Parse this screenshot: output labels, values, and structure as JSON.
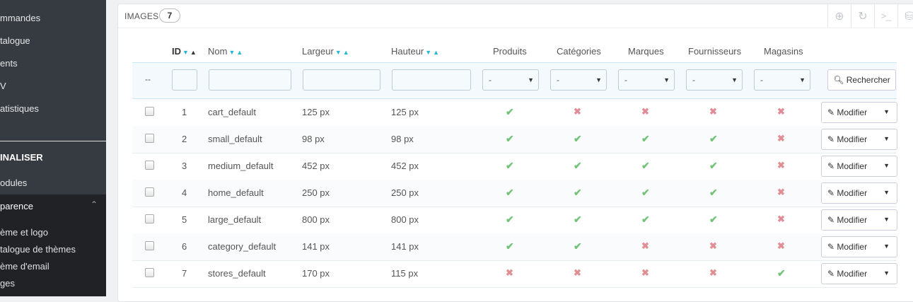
{
  "sidebar": {
    "items": [
      "mmandes",
      "talogue",
      "ents",
      "V",
      "atistiques"
    ],
    "section": "INALISER",
    "modules": "odules",
    "active": "parence",
    "sub": [
      "ème et logo",
      "talogue de thèmes",
      "ème d'email",
      "ges"
    ]
  },
  "panel": {
    "title": "IMAGES",
    "count": "7",
    "tools": [
      "plus-circle-icon",
      "refresh-icon",
      "terminal-icon",
      "database-icon"
    ]
  },
  "table": {
    "headers": {
      "id": "ID",
      "name": "Nom",
      "width": "Largeur",
      "height": "Hauteur",
      "products": "Produits",
      "categories": "Catégories",
      "brands": "Marques",
      "suppliers": "Fournisseurs",
      "stores": "Magasins"
    },
    "filter": {
      "dash": "--",
      "select_value": "-",
      "search_label": "Rechercher"
    },
    "rows": [
      {
        "id": "1",
        "name": "cart_default",
        "width": "125 px",
        "height": "125 px",
        "flags": [
          true,
          false,
          false,
          false,
          false
        ]
      },
      {
        "id": "2",
        "name": "small_default",
        "width": "98 px",
        "height": "98 px",
        "flags": [
          true,
          true,
          true,
          true,
          false
        ]
      },
      {
        "id": "3",
        "name": "medium_default",
        "width": "452 px",
        "height": "452 px",
        "flags": [
          true,
          true,
          true,
          true,
          false
        ]
      },
      {
        "id": "4",
        "name": "home_default",
        "width": "250 px",
        "height": "250 px",
        "flags": [
          true,
          true,
          true,
          true,
          false
        ]
      },
      {
        "id": "5",
        "name": "large_default",
        "width": "800 px",
        "height": "800 px",
        "flags": [
          true,
          true,
          true,
          true,
          false
        ]
      },
      {
        "id": "6",
        "name": "category_default",
        "width": "141 px",
        "height": "141 px",
        "flags": [
          true,
          true,
          false,
          false,
          false
        ]
      },
      {
        "id": "7",
        "name": "stores_default",
        "width": "170 px",
        "height": "115 px",
        "flags": [
          false,
          false,
          false,
          false,
          true
        ]
      }
    ],
    "edit_label": "Modifier"
  },
  "colors": {
    "ok": "#72c279",
    "no": "#e08f95",
    "accent": "#25b9d7",
    "sidebar": "#363a41"
  }
}
